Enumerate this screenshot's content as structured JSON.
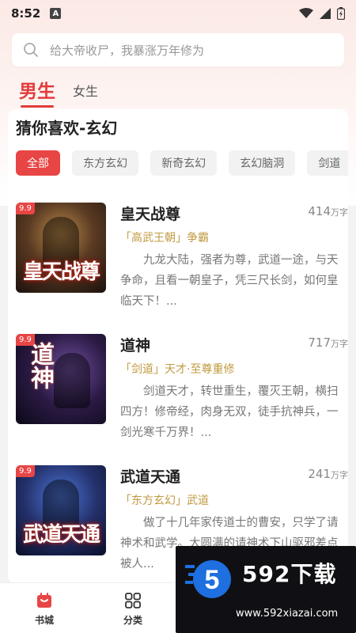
{
  "status_bar": {
    "time": "8:52",
    "notification_badge": "A"
  },
  "search": {
    "placeholder": "给大帝收尸，我暴涨万年修为"
  },
  "gender_tabs": [
    {
      "label": "男生",
      "active": true
    },
    {
      "label": "女生",
      "active": false
    }
  ],
  "section": {
    "title": "猜你喜欢-玄幻"
  },
  "chips": [
    {
      "label": "全部",
      "active": true
    },
    {
      "label": "东方玄幻",
      "active": false
    },
    {
      "label": "新奇玄幻",
      "active": false
    },
    {
      "label": "玄幻脑洞",
      "active": false
    },
    {
      "label": "剑道",
      "active": false
    }
  ],
  "books": [
    {
      "score": "9.9",
      "cover_text": "皇天战尊",
      "title": "皇天战尊",
      "word_count": "414",
      "word_unit": "万字",
      "tags": "「高武王朝」争霸",
      "description": "九龙大陆，强者为尊，武道一途，与天争命，且看一朝皇子，凭三尺长剑，如何皇临天下！..."
    },
    {
      "score": "9.9",
      "cover_text": "道神",
      "title": "道神",
      "word_count": "717",
      "word_unit": "万字",
      "tags": "「剑道」天才·至尊重修",
      "description": "剑道天才，转世重生，覆灭王朝，横扫四方！修帝经，肉身无双，徒手抗神兵，一剑光寒千万界！..."
    },
    {
      "score": "9.9",
      "cover_text": "武道天通",
      "title": "武道天通",
      "word_count": "241",
      "word_unit": "万字",
      "tags": "「东方玄幻」武道",
      "description": "做了十几年家传道士的曹安，只学了请神术和武学。大圆满的请神术下山驱邪差点被人..."
    }
  ],
  "bottom_nav": [
    {
      "label": "书城",
      "icon": "bookstore-icon",
      "active": true
    },
    {
      "label": "分类",
      "icon": "category-grid-icon",
      "active": false
    }
  ],
  "watermark": {
    "brand": "592下载",
    "url": "www.592xiazai.com"
  },
  "colors": {
    "accent": "#e84545",
    "tag": "#c09a3f"
  }
}
